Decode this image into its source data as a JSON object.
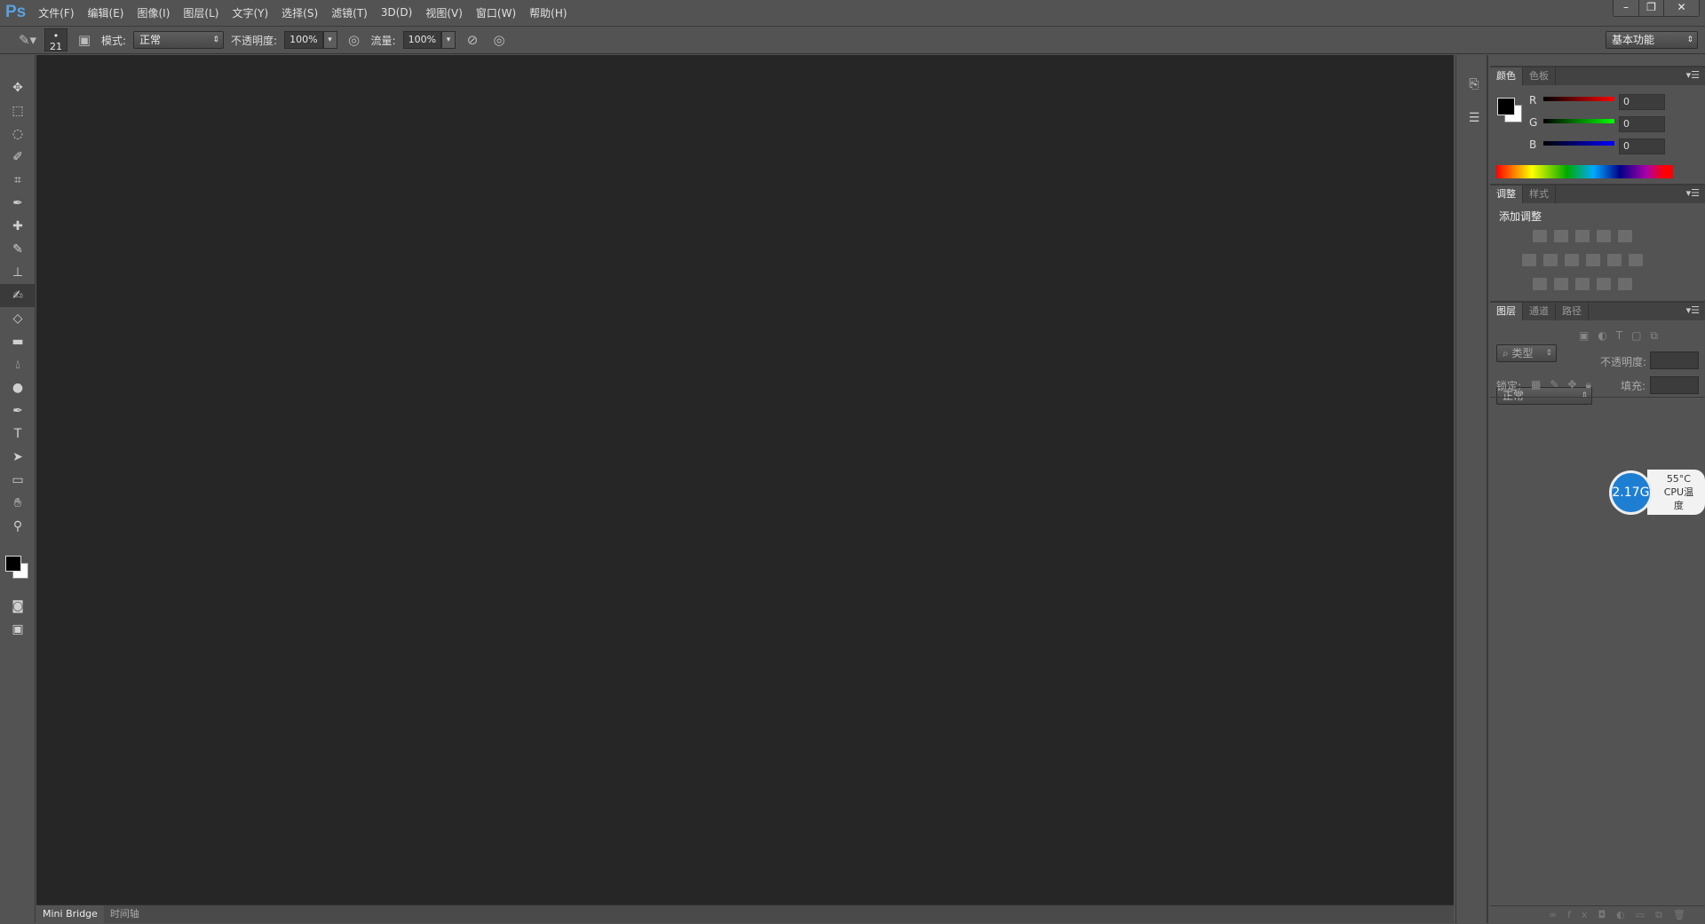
{
  "app": {
    "logo": "Ps"
  },
  "menu": [
    "文件(F)",
    "编辑(E)",
    "图像(I)",
    "图层(L)",
    "文字(Y)",
    "选择(S)",
    "滤镜(T)",
    "3D(D)",
    "视图(V)",
    "窗口(W)",
    "帮助(H)"
  ],
  "window": {
    "minimize": "–",
    "restore": "❐",
    "close": "✕"
  },
  "options": {
    "brush_size": "21",
    "mode_label": "模式:",
    "mode_value": "正常",
    "opacity_label": "不透明度:",
    "opacity_value": "100%",
    "flow_label": "流量:",
    "flow_value": "100%",
    "workspace": "基本功能"
  },
  "tools": [
    "move-tool",
    "marquee-tool",
    "lasso-tool",
    "quick-selection-tool",
    "crop-tool",
    "eyedropper-tool",
    "healing-brush-tool",
    "brush-tool",
    "clone-stamp-tool",
    "history-brush-tool",
    "eraser-tool",
    "gradient-tool",
    "blur-tool",
    "dodge-tool",
    "pen-tool",
    "type-tool",
    "path-selection-tool",
    "rectangle-tool",
    "hand-tool",
    "zoom-tool"
  ],
  "active_tool": "history-brush-tool",
  "bottom_tabs": [
    "Mini Bridge",
    "时间轴"
  ],
  "color_panel": {
    "tabs": [
      "颜色",
      "色板"
    ],
    "r_label": "R",
    "g_label": "G",
    "b_label": "B",
    "r": "0",
    "g": "0",
    "b": "0",
    "foreground": "#000000",
    "background": "#ffffff"
  },
  "adjust_panel": {
    "tabs": [
      "调整",
      "样式"
    ],
    "title": "添加调整"
  },
  "layers_panel": {
    "tabs": [
      "图层",
      "通道",
      "路径"
    ],
    "filter": "类型",
    "blend": "正常",
    "opacity_label": "不透明度:",
    "lock_label": "锁定:",
    "fill_label": "填充:"
  },
  "cpu_widget": {
    "freq": "2.17G",
    "temp": "55°C",
    "label": "CPU温度",
    "color": "#1e7fd2"
  }
}
